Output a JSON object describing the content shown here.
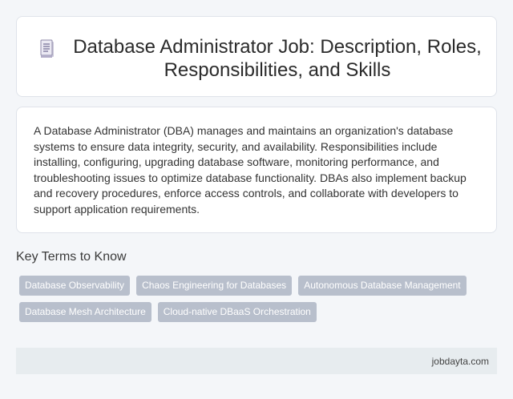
{
  "header": {
    "icon": "document-icon",
    "title": "Database Administrator Job: Description, Roles, Responsibilities, and Skills"
  },
  "description": "A Database Administrator (DBA) manages and maintains an organization's database systems to ensure data integrity, security, and availability. Responsibilities include installing, configuring, upgrading database software, monitoring performance, and troubleshooting issues to optimize database functionality. DBAs also implement backup and recovery procedures, enforce access controls, and collaborate with developers to support application requirements.",
  "key_terms": {
    "heading": "Key Terms to Know",
    "tags": [
      "Database Observability",
      "Chaos Engineering for Databases",
      "Autonomous Database Management",
      "Database Mesh Architecture",
      "Cloud-native DBaaS Orchestration"
    ]
  },
  "footer": {
    "site": "jobdayta.com"
  },
  "colors": {
    "background": "#f4f6f9",
    "card": "#ffffff",
    "tag": "#b8bfcc",
    "footer": "#e7ecef"
  }
}
